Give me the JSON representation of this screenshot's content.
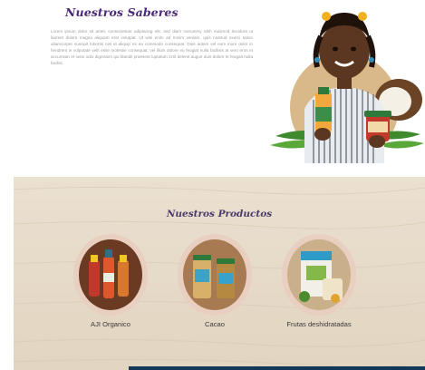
{
  "saberes": {
    "title": "Nuestros Saberes",
    "body": "Lorem ipsum dolor sit amet, consectetuer adipiscing elit, sed diam nonummy nibh euismod tincidunt ut laoreet dolore magna aliquam erat volutpat. Ut wisi enim ad minim veniam, quis nostrud exerci tation ullamcorper suscipit lobortis nisl ut aliquip ex ea commodo consequat. Duis autem vel eum iriure dolor in hendrerit in vulputate velit esse molestie consequat, vel illum dolore eu feugiat nulla facilisis at vero eros et accumsan et iusto odio dignissim qui blandit praesent luptatum zzril delenit augue duis dolore te feugait nulla facilisi."
  },
  "productos": {
    "title": "Nuestros Productos",
    "items": [
      {
        "label": "AJI Organico"
      },
      {
        "label": "Cacao"
      },
      {
        "label": "Frutas deshidratadas"
      }
    ]
  },
  "colors": {
    "title_purple": "#4a2a78",
    "section_bg": "#e6dac8",
    "circle_bg": "#d9b98a",
    "footer_bar": "#123757"
  }
}
